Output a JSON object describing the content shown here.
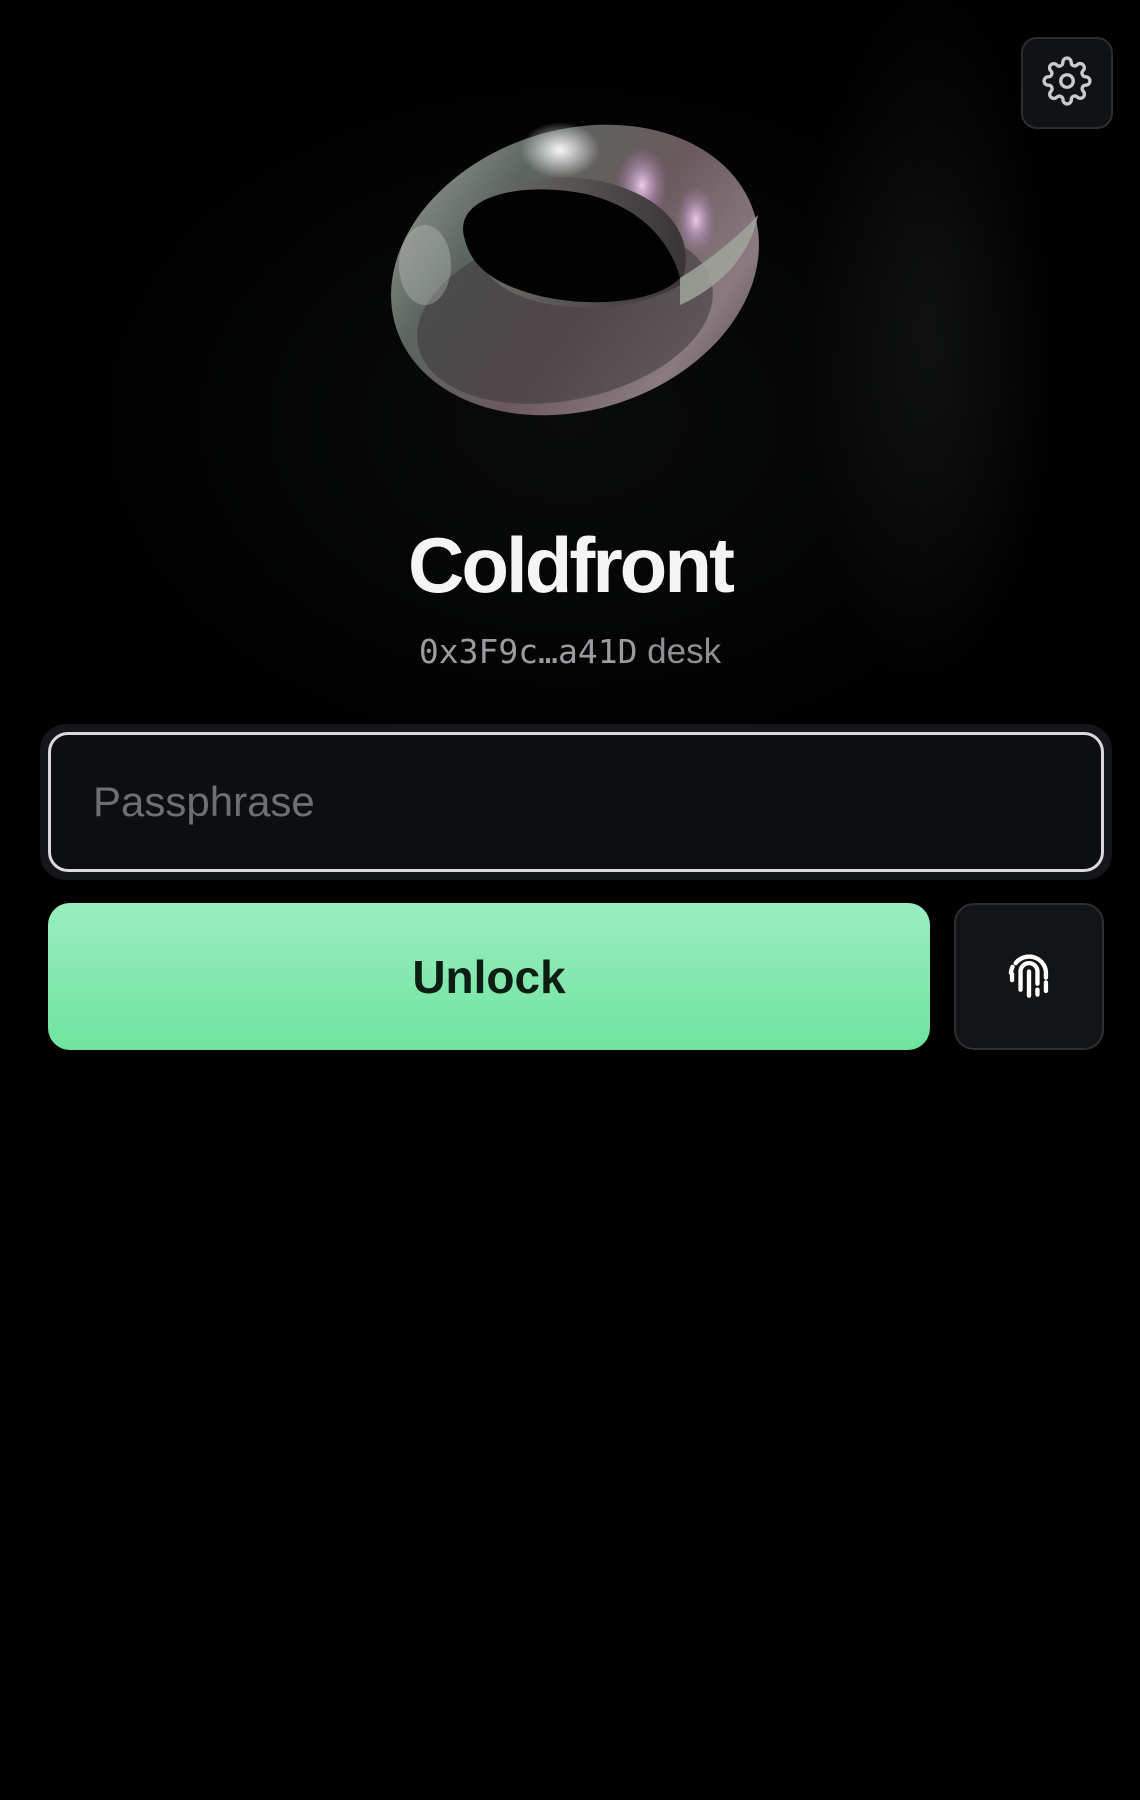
{
  "app": {
    "title": "Coldfront",
    "account_address": "0x3F9c…a41D",
    "account_name": "desk"
  },
  "form": {
    "passphrase_placeholder": "Passphrase",
    "passphrase_value": "",
    "unlock_label": "Unlock"
  },
  "icons": {
    "settings": "gear-icon",
    "biometric": "fingerprint-icon",
    "hero": "mobius-ring-logo"
  },
  "colors": {
    "background": "#000000",
    "accent": "#7ae6a6",
    "title": "#f5f5f5",
    "muted": "#8e9094"
  }
}
